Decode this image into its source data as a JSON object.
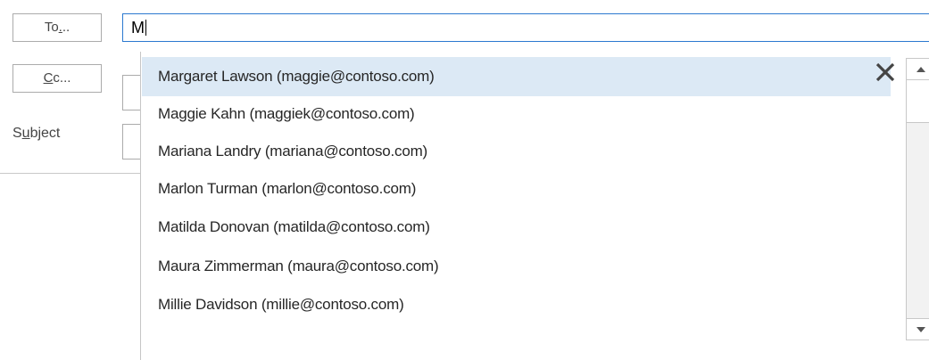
{
  "fields": {
    "to_button": {
      "prefix": "To",
      "underlined": ".",
      "suffix": ".."
    },
    "cc_button": {
      "underlined": "C",
      "suffix": "c..."
    },
    "subject_label": {
      "prefix": "S",
      "underlined": "u",
      "suffix": "bject"
    },
    "to_value": "M"
  },
  "autocomplete": {
    "items": [
      {
        "label": "Margaret Lawson (maggie@contoso.com)",
        "selected": true
      },
      {
        "label": "Maggie Kahn (maggiek@contoso.com)",
        "selected": false
      },
      {
        "label": "Mariana Landry (mariana@contoso.com)",
        "selected": false
      },
      {
        "label": "Marlon Turman (marlon@contoso.com)",
        "selected": false
      },
      {
        "label": "Matilda Donovan (matilda@contoso.com)",
        "selected": false
      },
      {
        "label": "Maura Zimmerman (maura@contoso.com)",
        "selected": false
      },
      {
        "label": "Millie Davidson (millie@contoso.com)",
        "selected": false
      }
    ],
    "remove_icon": "close-icon",
    "scroll_up_icon": "scroll-up-arrow-icon",
    "scroll_down_icon": "scroll-down-arrow-icon"
  },
  "colors": {
    "focus_border": "#2b79d0",
    "selected_row": "#dce9f5"
  }
}
